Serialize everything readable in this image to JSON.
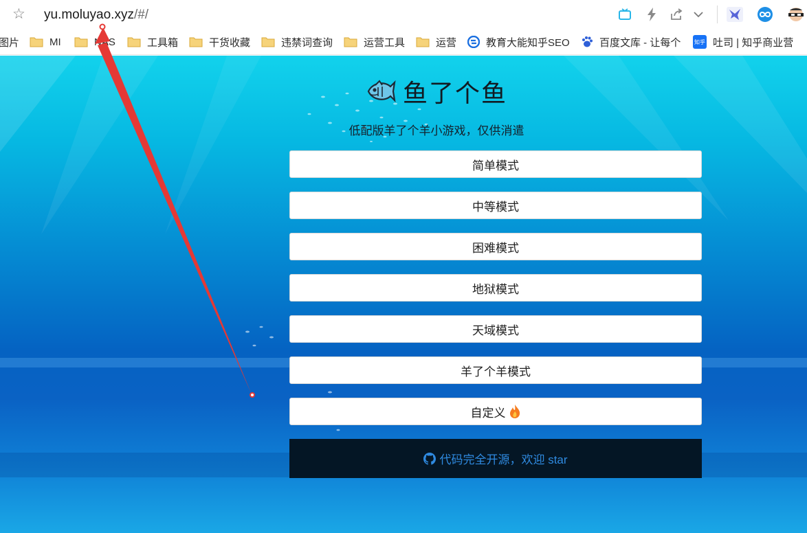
{
  "browser": {
    "url_host": "yu.moluyao.xyz",
    "url_path": "/#/",
    "bookmarks": [
      {
        "label": "图片",
        "icon": "none"
      },
      {
        "label": "MI",
        "icon": "folder-icon"
      },
      {
        "label": "NAS",
        "icon": "folder-icon"
      },
      {
        "label": "工具箱",
        "icon": "folder-icon"
      },
      {
        "label": "干货收藏",
        "icon": "folder-icon"
      },
      {
        "label": "违禁词查询",
        "icon": "folder-icon"
      },
      {
        "label": "运营工具",
        "icon": "folder-icon"
      },
      {
        "label": "运营",
        "icon": "folder-icon"
      },
      {
        "label": "教育大能知乎SEO",
        "icon": "sogou-icon"
      },
      {
        "label": "百度文库 - 让每个",
        "icon": "baidu-paw-icon"
      },
      {
        "label": "吐司 | 知乎商业营",
        "icon": "zhihu-icon",
        "icon_text": "知乎"
      }
    ]
  },
  "page": {
    "title": "鱼了个鱼",
    "subtitle": "低配版羊了个羊小游戏，仅供消遣",
    "modes": [
      {
        "label": "简单模式"
      },
      {
        "label": "中等模式"
      },
      {
        "label": "困难模式"
      },
      {
        "label": "地狱模式"
      },
      {
        "label": "天域模式"
      },
      {
        "label": "羊了个羊模式"
      },
      {
        "label": "自定义"
      }
    ],
    "footer_text": "代码完全开源，欢迎 star"
  },
  "colors": {
    "annotation": "#e53935",
    "footer_bg": "#041625",
    "footer_text": "#2f8ae0"
  }
}
